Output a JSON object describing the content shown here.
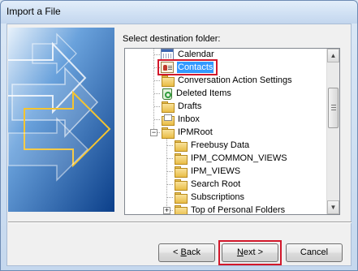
{
  "window": {
    "title": "Import a File"
  },
  "prompt": "Select destination folder:",
  "tree": {
    "items": [
      {
        "label": "Calendar",
        "icon": "calendar-icon",
        "level": 1
      },
      {
        "label": "Contacts",
        "icon": "contacts-icon",
        "level": 1,
        "selected": true
      },
      {
        "label": "Conversation Action Settings",
        "icon": "folder-icon",
        "level": 1
      },
      {
        "label": "Deleted Items",
        "icon": "deleted-items-icon",
        "level": 1
      },
      {
        "label": "Drafts",
        "icon": "folder-icon",
        "level": 1
      },
      {
        "label": "Inbox",
        "icon": "inbox-icon",
        "level": 1
      },
      {
        "label": "IPMRoot",
        "icon": "folder-icon",
        "level": 1,
        "expander": "-"
      },
      {
        "label": "Freebusy Data",
        "icon": "folder-icon",
        "level": 2
      },
      {
        "label": "IPM_COMMON_VIEWS",
        "icon": "folder-icon",
        "level": 2
      },
      {
        "label": "IPM_VIEWS",
        "icon": "folder-icon",
        "level": 2
      },
      {
        "label": "Search Root",
        "icon": "folder-icon",
        "level": 2
      },
      {
        "label": "Subscriptions",
        "icon": "folder-icon",
        "level": 2
      },
      {
        "label": "Top of Personal Folders",
        "icon": "folder-icon",
        "level": 2,
        "expander": "+"
      }
    ]
  },
  "buttons": {
    "back_prefix": "< ",
    "back_key": "B",
    "back_rest": "ack",
    "next_key": "N",
    "next_rest": "ext >",
    "cancel": "Cancel"
  },
  "colors": {
    "selection": "#3399ff",
    "annotation_red": "#d2182b"
  }
}
